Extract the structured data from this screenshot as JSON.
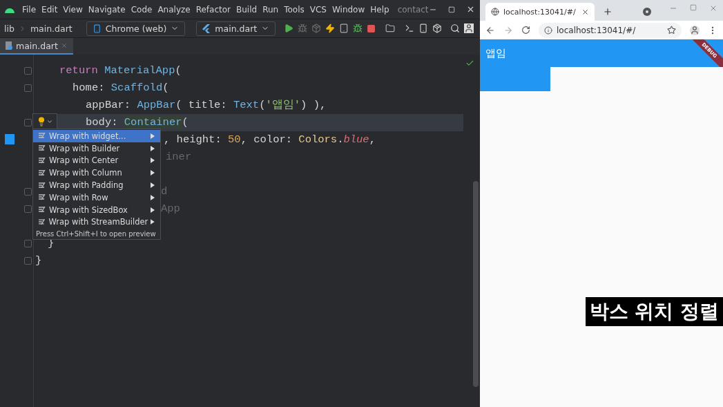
{
  "ide": {
    "menu": [
      "File",
      "Edit",
      "View",
      "Navigate",
      "Code",
      "Analyze",
      "Refactor",
      "Build",
      "Run",
      "Tools",
      "VCS",
      "Window",
      "Help"
    ],
    "project_title": "contact",
    "breadcrumb": [
      "lib",
      "main.dart"
    ],
    "device_selector": "Chrome (web)",
    "run_config": "main.dart",
    "tabs": [
      {
        "label": "main.dart",
        "selected": true
      }
    ],
    "code_lines": [
      {
        "current": false,
        "tokens": [
          {
            "kind": "keyword",
            "text": "return "
          },
          {
            "kind": "class",
            "text": "MaterialApp"
          },
          {
            "kind": "plain",
            "text": "("
          }
        ]
      },
      {
        "current": false,
        "tokens": [
          {
            "kind": "plain",
            "text": "home: "
          },
          {
            "kind": "class",
            "text": "Scaffold"
          },
          {
            "kind": "plain",
            "text": "("
          }
        ]
      },
      {
        "current": false,
        "tokens": [
          {
            "kind": "plain",
            "text": "appBar: "
          },
          {
            "kind": "class",
            "text": "AppBar"
          },
          {
            "kind": "plain",
            "text": "( title: "
          },
          {
            "kind": "class",
            "text": "Text"
          },
          {
            "kind": "plain",
            "text": "("
          },
          {
            "kind": "string",
            "text": "'앱임'"
          },
          {
            "kind": "plain",
            "text": ") ),"
          }
        ]
      },
      {
        "current": true,
        "tokens": [
          {
            "kind": "plain",
            "text": "body: "
          },
          {
            "kind": "match",
            "text": "Container"
          },
          {
            "kind": "plain",
            "text": "("
          }
        ]
      },
      {
        "current": false,
        "tokens": [
          {
            "kind": "plain",
            "text": ", height: "
          },
          {
            "kind": "number",
            "text": "50"
          },
          {
            "kind": "plain",
            "text": ", color: "
          },
          {
            "kind": "const",
            "text": "Colors"
          },
          {
            "kind": "plain",
            "text": "."
          },
          {
            "kind": "field",
            "text": "blue"
          },
          {
            "kind": "plain",
            "text": ","
          }
        ]
      },
      {
        "current": false,
        "tokens": [
          {
            "kind": "ghost",
            "text": "iner"
          }
        ]
      },
      {
        "current": false,
        "tokens": [
          {
            "kind": "ghost",
            "text": "d"
          }
        ]
      },
      {
        "current": false,
        "tokens": [
          {
            "kind": "ghost",
            "text": "App"
          }
        ]
      },
      {
        "current": false,
        "tokens": [
          {
            "kind": "plain",
            "text": "}"
          }
        ]
      },
      {
        "current": false,
        "tokens": [
          {
            "kind": "plain",
            "text": "}"
          }
        ]
      }
    ],
    "intention_menu": {
      "items": [
        {
          "label": "Wrap with widget...",
          "selected": true
        },
        {
          "label": "Wrap with Builder",
          "selected": false
        },
        {
          "label": "Wrap with Center",
          "selected": false
        },
        {
          "label": "Wrap with Column",
          "selected": false
        },
        {
          "label": "Wrap with Padding",
          "selected": false
        },
        {
          "label": "Wrap with Row",
          "selected": false
        },
        {
          "label": "Wrap with SizedBox",
          "selected": false
        },
        {
          "label": "Wrap with StreamBuilder",
          "selected": false
        }
      ],
      "hint": "Press Ctrl+Shift+I to open preview"
    }
  },
  "browser": {
    "tab": {
      "title": "localhost:13041/#/"
    },
    "address": "localhost:13041/#/",
    "app": {
      "app_bar_title": "앱임",
      "debug_banner": "DEBUG"
    }
  },
  "caption": "박스 위치 정렬"
}
